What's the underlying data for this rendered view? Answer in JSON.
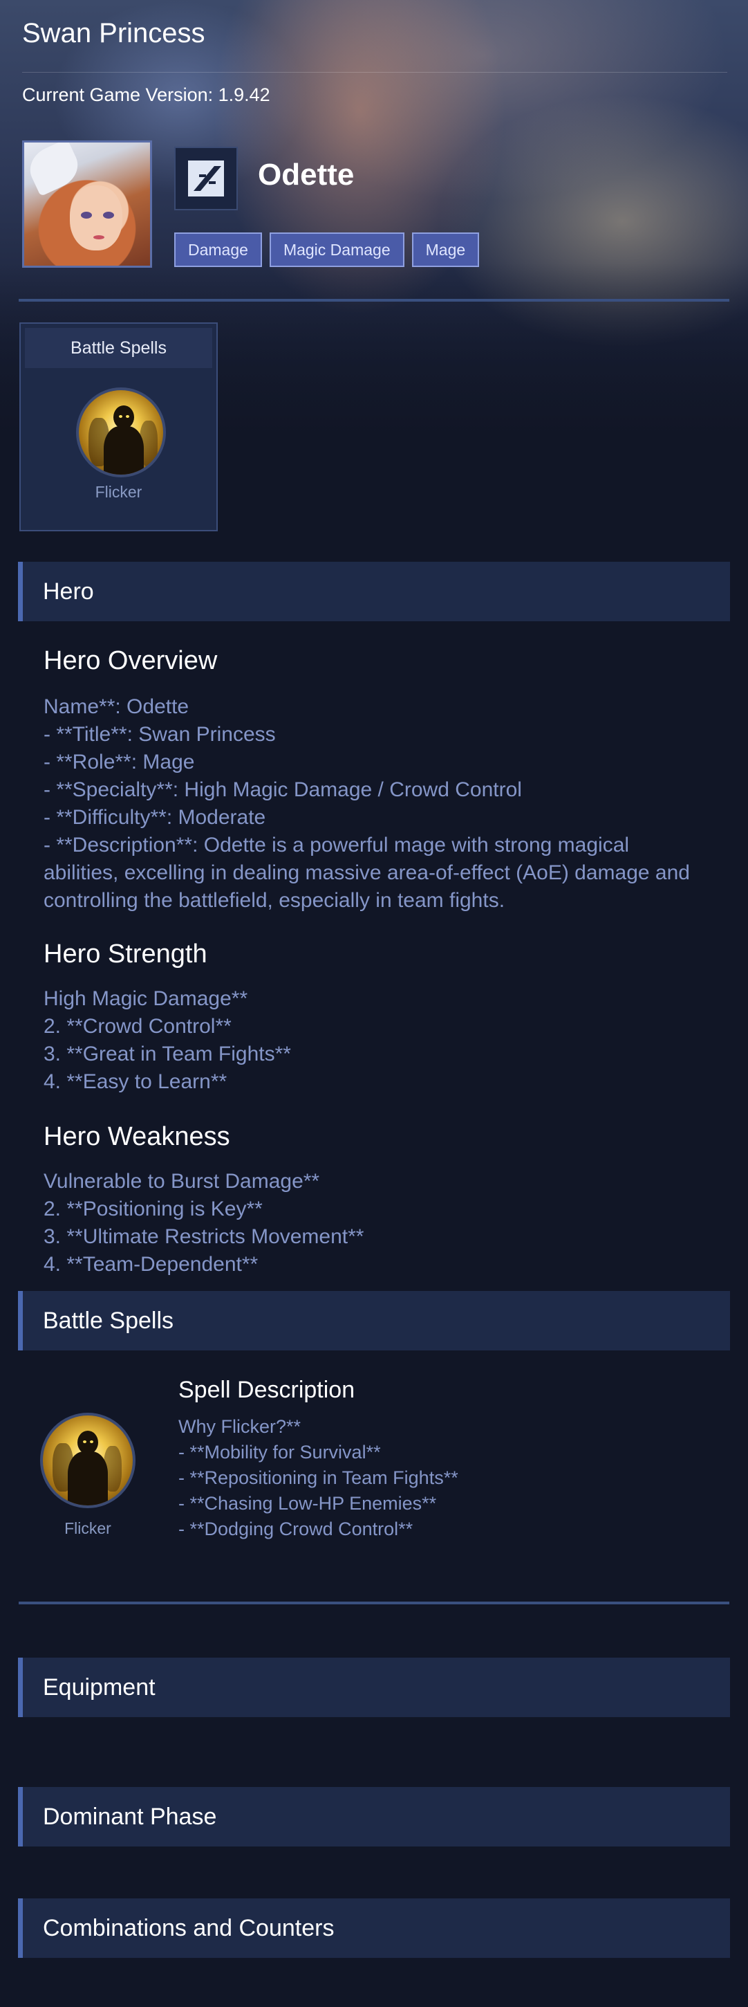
{
  "page": {
    "title": "Swan Princess",
    "version_text": "Current Game Version: 1.9.42"
  },
  "hero": {
    "name": "Odette",
    "role_icon": "mage-role-icon",
    "tags": [
      "Damage",
      "Magic Damage",
      "Mage"
    ]
  },
  "battle_spells_card": {
    "title": "Battle Spells",
    "spell_name": "Flicker",
    "spell_icon": "flicker-icon"
  },
  "sections": {
    "hero": "Hero",
    "battle_spells": "Battle Spells",
    "equipment": "Equipment",
    "dominant_phase": "Dominant Phase",
    "combinations": "Combinations and Counters"
  },
  "overview": {
    "title": "Hero Overview",
    "text": "Name**: Odette\n- **Title**: Swan Princess\n- **Role**: Mage\n- **Specialty**: High Magic Damage / Crowd Control\n- **Difficulty**: Moderate\n- **Description**: Odette is a powerful mage with strong magical abilities, excelling in dealing massive area-of-effect (AoE) damage and controlling the battlefield, especially in team fights."
  },
  "strength": {
    "title": "Hero Strength",
    "text": "High Magic Damage**\n2. **Crowd Control**\n3. **Great in Team Fights**\n4. **Easy to Learn**"
  },
  "weakness": {
    "title": "Hero Weakness",
    "text": "Vulnerable to Burst Damage**\n2. **Positioning is Key**\n3. **Ultimate Restricts Movement**\n4. **Team-Dependent**"
  },
  "spell_section": {
    "spell_name": "Flicker",
    "desc_title": "Spell Description",
    "desc_text": "Why Flicker?**\n- **Mobility for Survival**\n- **Repositioning in Team Fights**\n- **Chasing Low-HP Enemies**\n- **Dodging Crowd Control**"
  },
  "colors": {
    "background": "#111626",
    "section_bg": "#1e2a48",
    "accent": "#4b68b0",
    "tag_bg": "#4a5ba8",
    "muted_text": "#8596c8"
  }
}
